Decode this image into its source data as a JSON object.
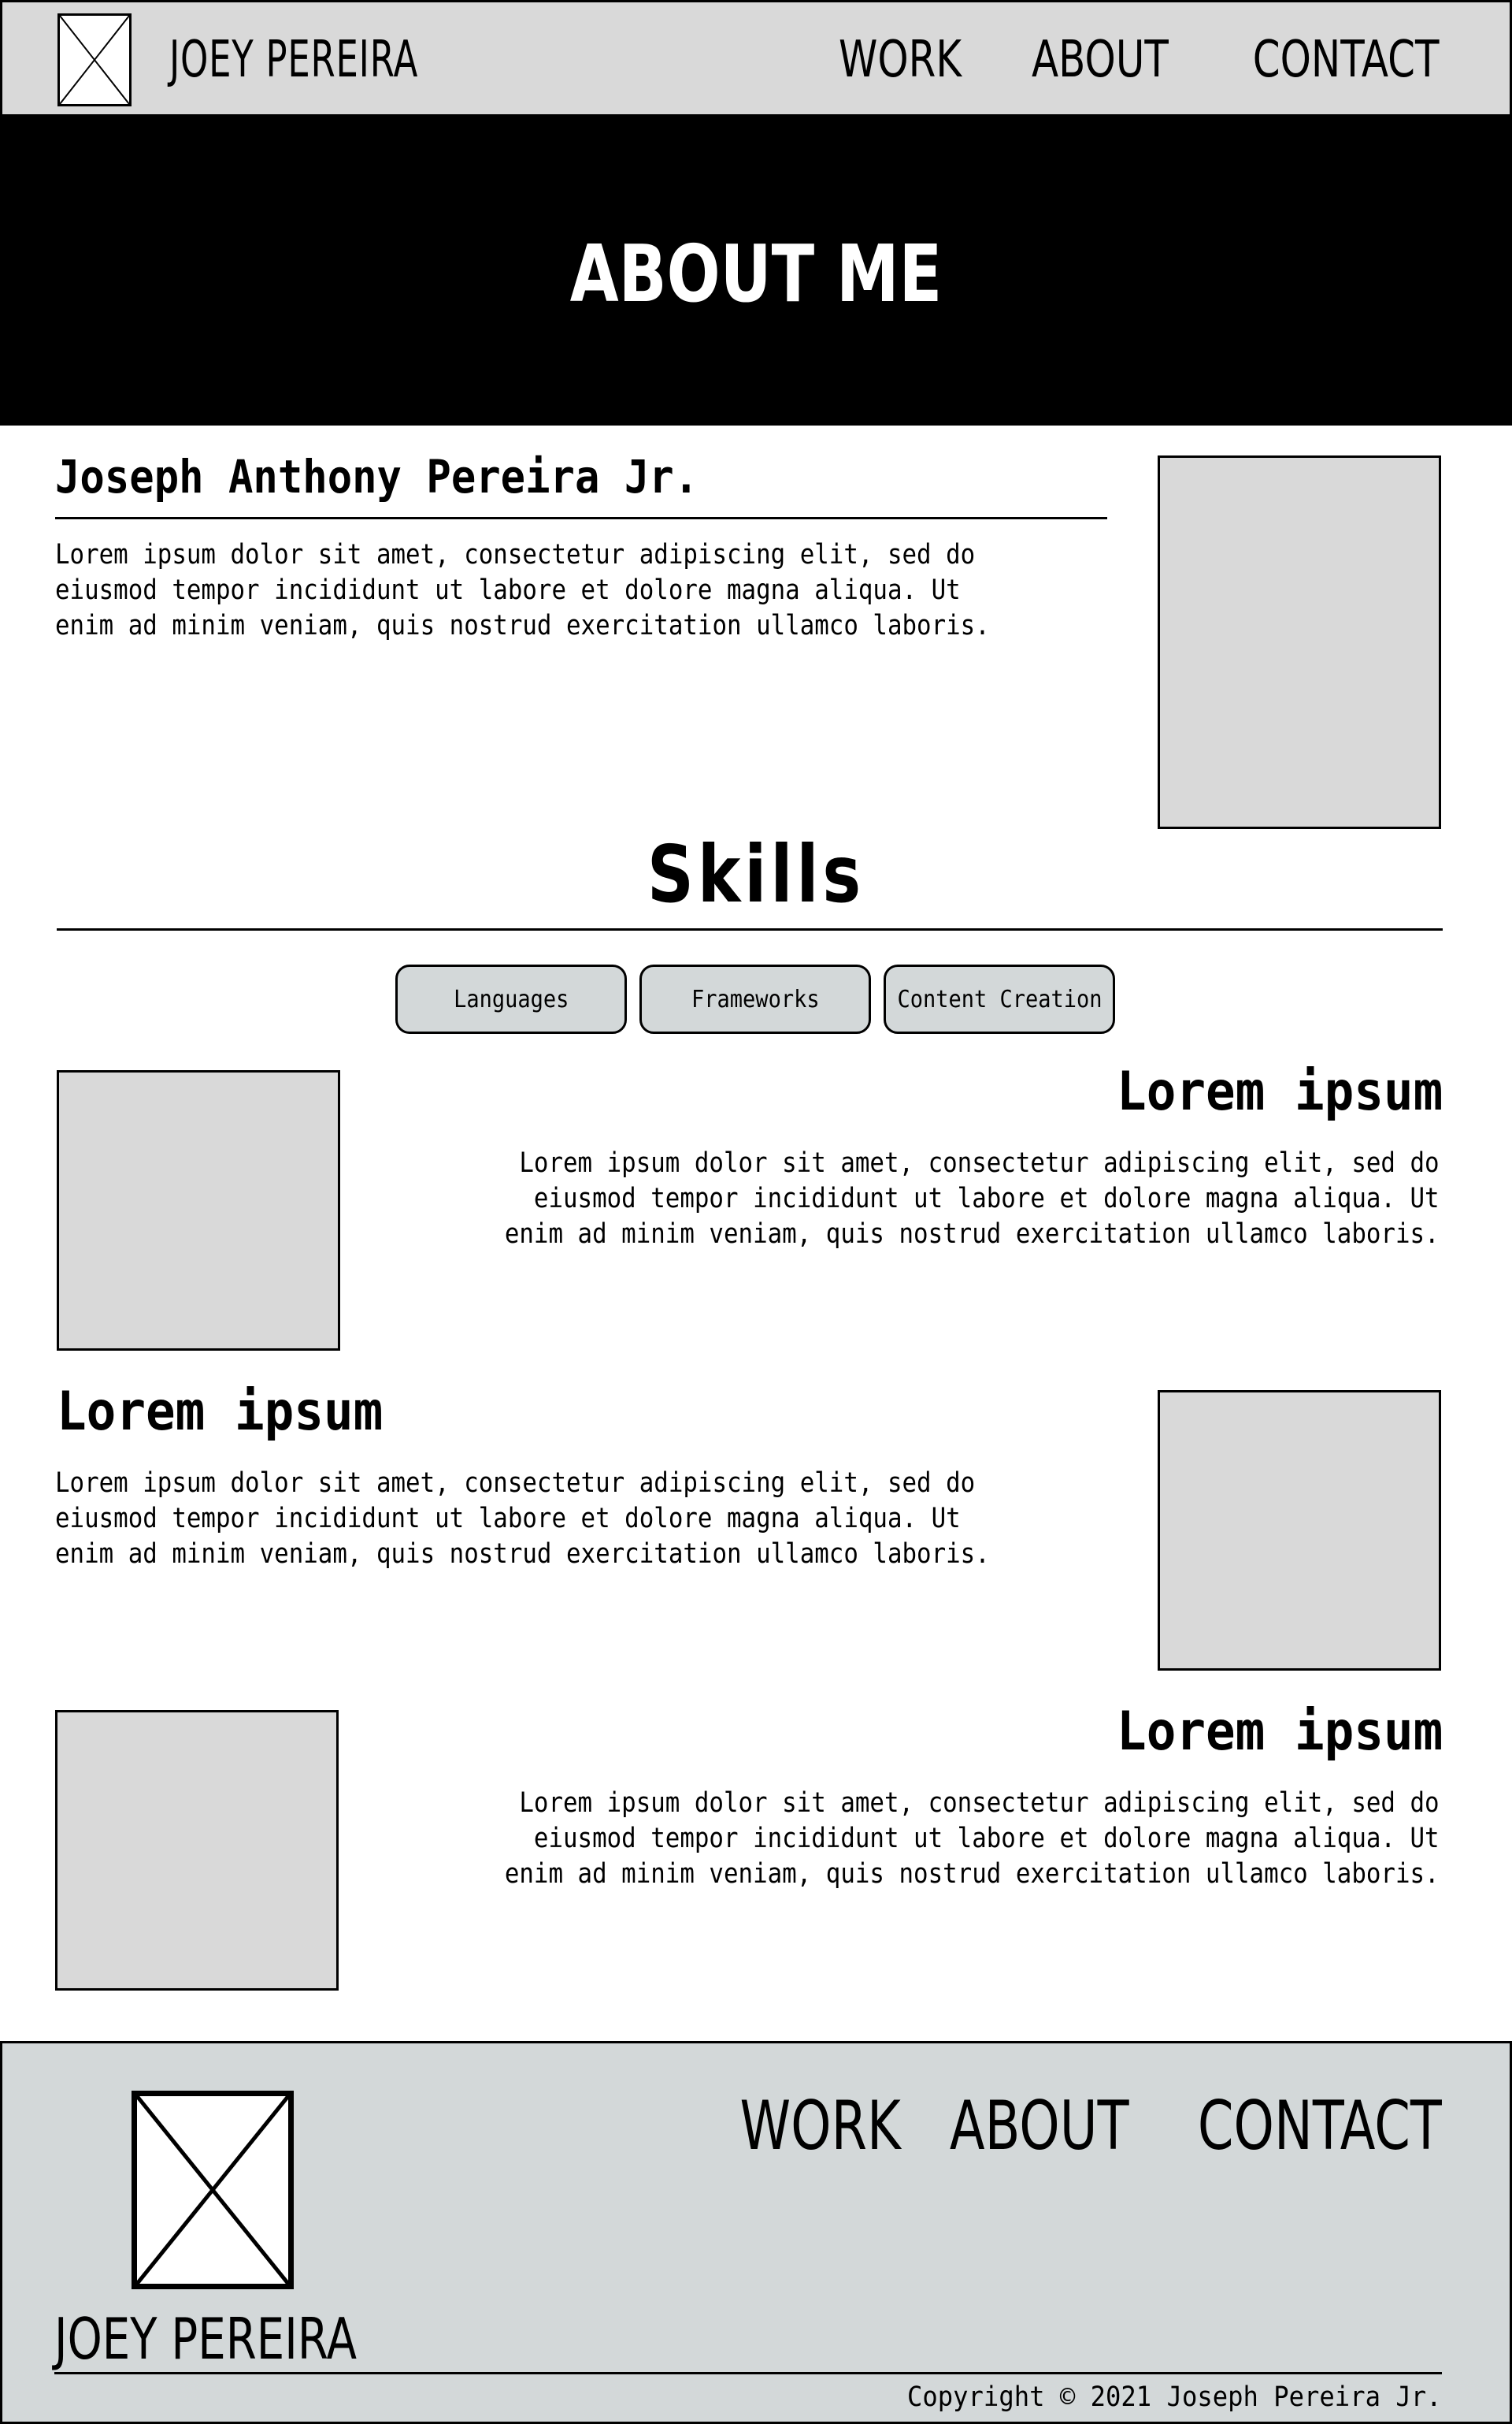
{
  "header": {
    "logo_icon": "image-placeholder-icon",
    "brand": "JOEY PEREIRA",
    "nav": [
      "WORK",
      "ABOUT",
      "CONTACT"
    ]
  },
  "hero": {
    "title": "ABOUT ME"
  },
  "intro": {
    "name": "Joseph Anthony Pereira Jr.",
    "text_lines": [
      "Lorem ipsum dolor sit amet, consectetur adipiscing elit, sed do",
      "eiusmod tempor incididunt ut labore et dolore magna aliqua. Ut",
      "enim ad minim veniam, quis nostrud exercitation ullamco laboris."
    ]
  },
  "skills": {
    "title": "Skills",
    "tabs": [
      "Languages",
      "Frameworks",
      "Content Creation"
    ],
    "items": [
      {
        "title": "Lorem ipsum",
        "text_lines": [
          "Lorem ipsum dolor sit amet, consectetur adipiscing elit, sed do",
          "eiusmod tempor incididunt ut labore et dolore magna aliqua. Ut",
          "enim ad minim veniam, quis nostrud exercitation ullamco laboris."
        ]
      },
      {
        "title": "Lorem ipsum",
        "text_lines": [
          "Lorem ipsum dolor sit amet, consectetur adipiscing elit, sed do",
          "eiusmod tempor incididunt ut labore et dolore magna aliqua. Ut",
          "enim ad minim veniam, quis nostrud exercitation ullamco laboris."
        ]
      },
      {
        "title": "Lorem ipsum",
        "text_lines": [
          "Lorem ipsum dolor sit amet, consectetur adipiscing elit, sed do",
          "eiusmod tempor incididunt ut labore et dolore magna aliqua. Ut",
          "enim ad minim veniam, quis nostrud exercitation ullamco laboris."
        ]
      }
    ]
  },
  "footer": {
    "logo_icon": "image-placeholder-icon",
    "brand": "JOEY PEREIRA",
    "nav": [
      "WORK",
      "ABOUT",
      "CONTACT"
    ],
    "copyright": "Copyright © 2021 Joseph Pereira Jr."
  },
  "colors": {
    "header_bg": "#d9d9d9",
    "hero_bg": "#000000",
    "placeholder_bg": "#d9d9d9",
    "tab_bg": "#d3d8d9",
    "footer_bg": "#d3d8d9"
  }
}
